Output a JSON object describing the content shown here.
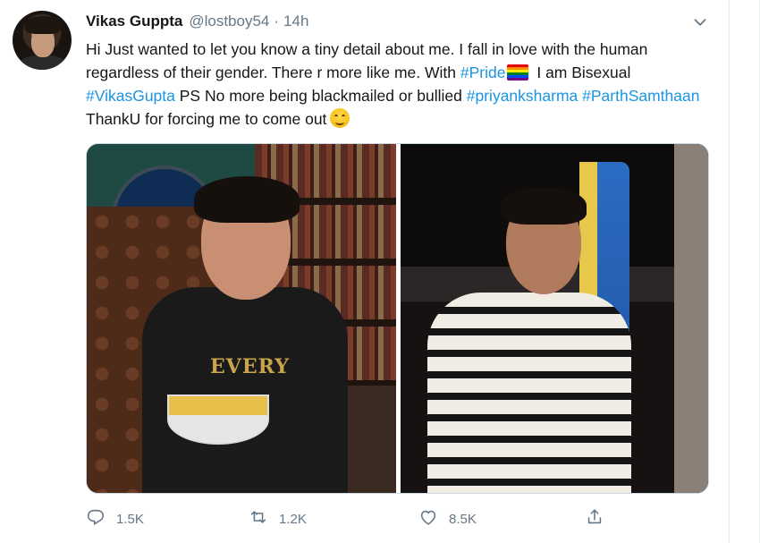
{
  "tweet": {
    "author_name": "Vikas Guppta",
    "author_handle": "@lostboy54",
    "separator": "·",
    "timestamp": "14h",
    "text_parts": {
      "intro": "Hi Just wanted to let you know a tiny detail about me. I fall in love with the human regardless of their gender. There r more like me. With ",
      "hashtag_pride": "#Pride",
      "mid1": " I am Bisexual ",
      "hashtag_vikas": "#VikasGupta",
      "mid2": " PS No more being blackmailed or bullied ",
      "hashtag_priyank": "#priyanksharma",
      "space": " ",
      "hashtag_parth": "#ParthSamthaan",
      "outro": " ThankU for forcing me to come out"
    },
    "emojis": [
      "rainbow-flag",
      "smiling-face"
    ],
    "media": {
      "left_photo_shirt_text": "EVERY",
      "photos": [
        "person-with-bowl-photo",
        "person-in-striped-shirt-photo"
      ]
    },
    "actions": {
      "replies": "1.5K",
      "retweets": "1.2K",
      "likes": "8.5K"
    },
    "icons": [
      "reply-icon",
      "retweet-icon",
      "like-icon",
      "share-icon",
      "chevron-down-icon"
    ]
  },
  "colors": {
    "link": "#1b95e0",
    "secondary_text": "#657786",
    "primary_text": "#14171a"
  }
}
